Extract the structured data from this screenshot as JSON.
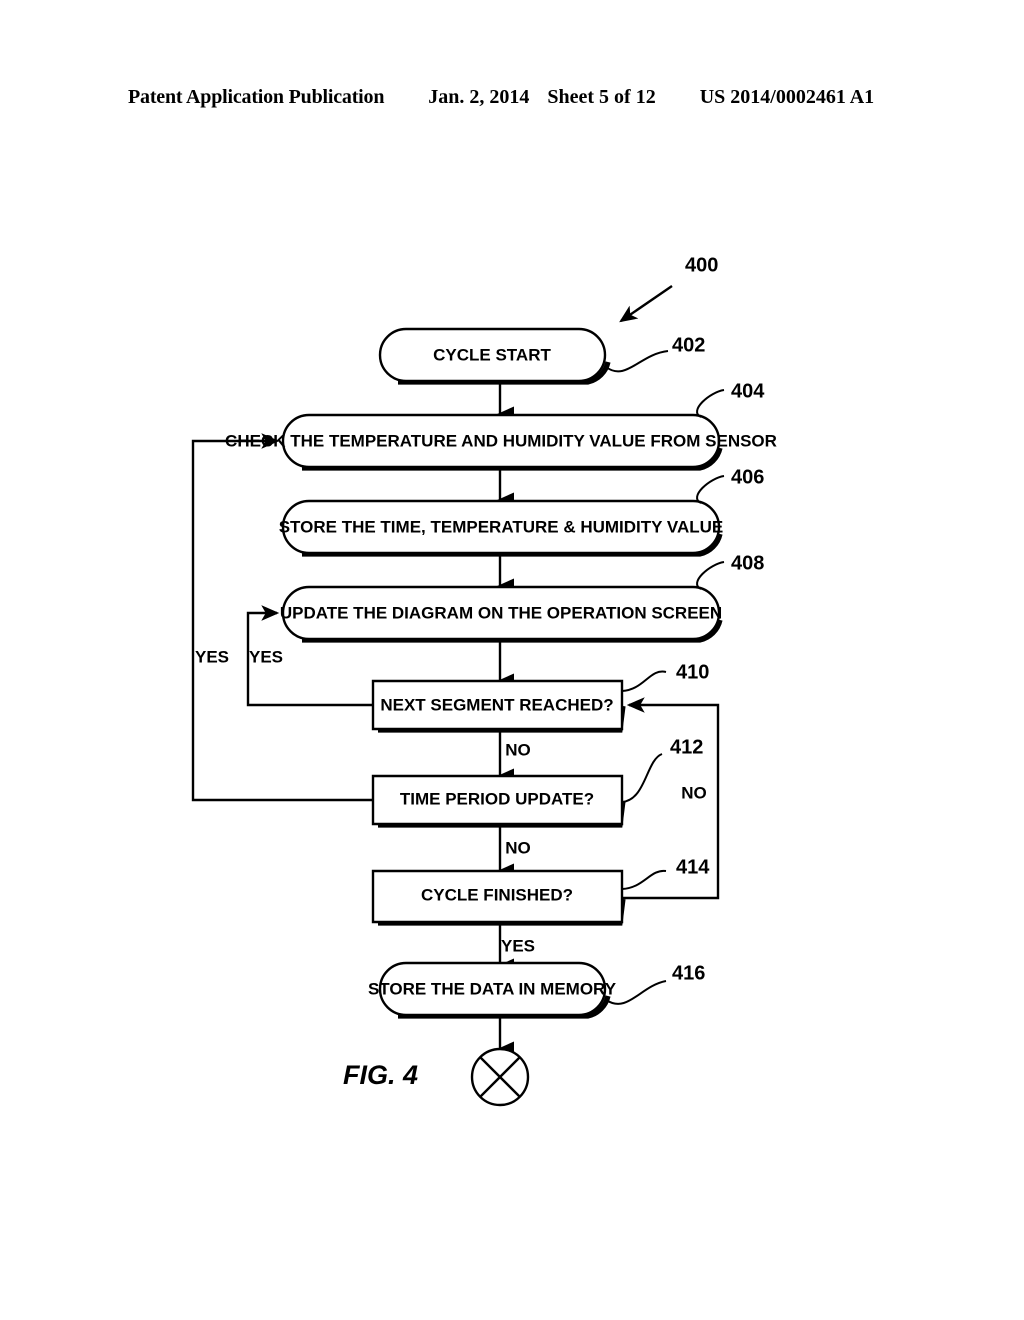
{
  "header": {
    "publication": "Patent Application Publication",
    "date": "Jan. 2, 2014",
    "sheet": "Sheet 5 of 12",
    "number": "US 2014/0002461 A1"
  },
  "figure": {
    "caption": "FIG. 4",
    "diagram_ref": "400",
    "terminator_symbol": "crossed-circle"
  },
  "chart_data": {
    "type": "flowchart",
    "title": "FIG. 4",
    "diagram_reference": "400",
    "nodes": [
      {
        "id": "402",
        "ref": "402",
        "shape": "stadium",
        "label": "CYCLE START"
      },
      {
        "id": "404",
        "ref": "404",
        "shape": "stadium",
        "label": "CHECK THE TEMPERATURE AND HUMIDITY VALUE FROM SENSOR"
      },
      {
        "id": "406",
        "ref": "406",
        "shape": "stadium",
        "label": "STORE THE TIME, TEMPERATURE & HUMIDITY VALUE"
      },
      {
        "id": "408",
        "ref": "408",
        "shape": "stadium",
        "label": "UPDATE THE DIAGRAM ON THE OPERATION SCREEN"
      },
      {
        "id": "410",
        "ref": "410",
        "shape": "decision",
        "label": "NEXT SEGMENT REACHED?"
      },
      {
        "id": "412",
        "ref": "412",
        "shape": "decision",
        "label": "TIME PERIOD UPDATE?"
      },
      {
        "id": "414",
        "ref": "414",
        "shape": "decision",
        "label": "CYCLE FINISHED?"
      },
      {
        "id": "416",
        "ref": "416",
        "shape": "stadium",
        "label": "STORE THE DATA IN MEMORY"
      },
      {
        "id": "end",
        "ref": "",
        "shape": "crossed-circle",
        "label": ""
      }
    ],
    "edges": [
      {
        "from": "402",
        "to": "404",
        "label": ""
      },
      {
        "from": "404",
        "to": "406",
        "label": ""
      },
      {
        "from": "406",
        "to": "408",
        "label": ""
      },
      {
        "from": "408",
        "to": "410",
        "label": ""
      },
      {
        "from": "410",
        "to": "408",
        "label": "YES"
      },
      {
        "from": "410",
        "to": "412",
        "label": "NO"
      },
      {
        "from": "412",
        "to": "404",
        "label": "YES"
      },
      {
        "from": "412",
        "to": "414",
        "label": "NO"
      },
      {
        "from": "414",
        "to": "410",
        "label": "NO"
      },
      {
        "from": "414",
        "to": "416",
        "label": "YES"
      },
      {
        "from": "416",
        "to": "end",
        "label": ""
      }
    ]
  },
  "nodes": {
    "n402": {
      "label": "CYCLE START",
      "ref": "402"
    },
    "n404": {
      "label": "CHECK THE TEMPERATURE AND HUMIDITY VALUE FROM SENSOR",
      "ref": "404"
    },
    "n406": {
      "label": "STORE THE TIME, TEMPERATURE & HUMIDITY VALUE",
      "ref": "406"
    },
    "n408": {
      "label": "UPDATE THE DIAGRAM ON THE OPERATION SCREEN",
      "ref": "408"
    },
    "n410": {
      "label": "NEXT SEGMENT REACHED?",
      "ref": "410"
    },
    "n412": {
      "label": "TIME PERIOD UPDATE?",
      "ref": "412"
    },
    "n414": {
      "label": "CYCLE FINISHED?",
      "ref": "414"
    },
    "n416": {
      "label": "STORE THE DATA IN MEMORY",
      "ref": "416"
    }
  },
  "edge_labels": {
    "yes_outer": "YES",
    "yes_inner": "YES",
    "no_410_412": "NO",
    "no_412_414": "NO",
    "no_414_410": "NO",
    "yes_414_416": "YES"
  },
  "colors": {
    "ink": "#000000",
    "paper": "#ffffff"
  }
}
